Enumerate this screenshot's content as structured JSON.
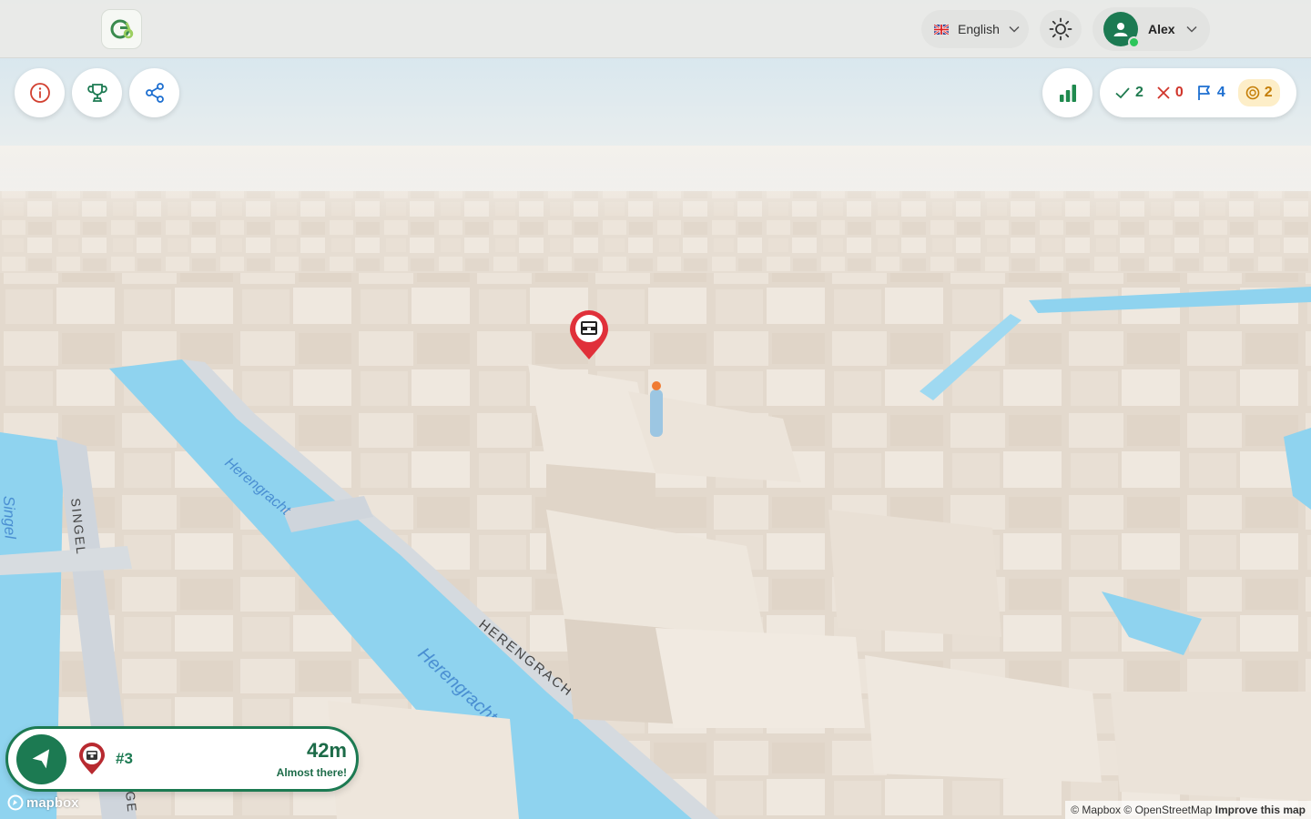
{
  "header": {
    "language": "English",
    "user_name": "Alex"
  },
  "scores": {
    "correct": "2",
    "wrong": "0",
    "flags": "4",
    "coins": "2"
  },
  "map": {
    "street_labels": [
      {
        "text": "Herengracht",
        "color": "#4a8fd2"
      },
      {
        "text": "Singel",
        "color": "#4a8fd2"
      },
      {
        "text": "SINGEL",
        "color": "#444444"
      },
      {
        "text": "HERENGRACHT",
        "color": "#444444"
      },
      {
        "text": "Herengracht",
        "color": "#4a8fd2"
      },
      {
        "text": "GE",
        "color": "#444444"
      }
    ]
  },
  "navigation": {
    "target_number": "#3",
    "distance": "42m",
    "hint": "Almost there!"
  },
  "attribution": {
    "logo_text": "mapbox",
    "mapbox": "© Mapbox",
    "osm": "© OpenStreetMap",
    "improve": "Improve this map"
  },
  "colors": {
    "brand_green": "#1c7a52",
    "marker_red": "#e0303a",
    "water": "#8fd3ef",
    "building": "#e8e0d5"
  }
}
